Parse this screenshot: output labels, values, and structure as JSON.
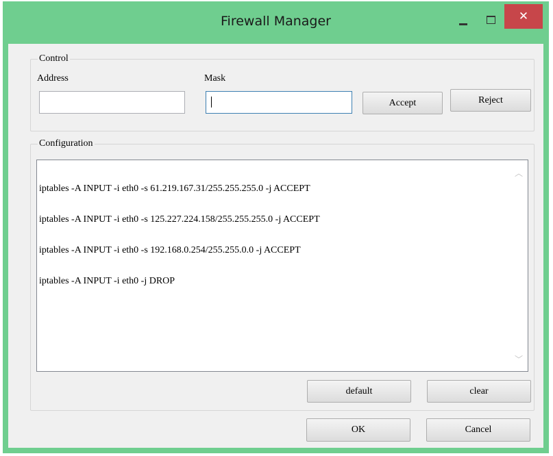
{
  "window": {
    "title": "Firewall Manager",
    "title_color": "#6fce8f",
    "close_color": "#c7464a",
    "minimize_icon": "minimize-icon",
    "maximize_icon": "maximize-icon",
    "close_icon": "close-icon",
    "close_glyph": "✕"
  },
  "control": {
    "legend": "Control",
    "address_label": "Address",
    "address_value": "",
    "mask_label": "Mask",
    "mask_value": "",
    "accept_label": "Accept",
    "reject_label": "Reject"
  },
  "configuration": {
    "legend": "Configuration",
    "lines": [
      "iptables -A INPUT -i eth0 -s 61.219.167.31/255.255.255.0 -j ACCEPT",
      "iptables -A INPUT -i eth0 -s 125.227.224.158/255.255.255.0 -j ACCEPT",
      "iptables -A INPUT -i eth0 -s 192.168.0.254/255.255.0.0 -j ACCEPT",
      "iptables -A INPUT -i eth0 -j DROP"
    ],
    "default_label": "default",
    "clear_label": "clear"
  },
  "footer": {
    "ok_label": "OK",
    "cancel_label": "Cancel"
  }
}
